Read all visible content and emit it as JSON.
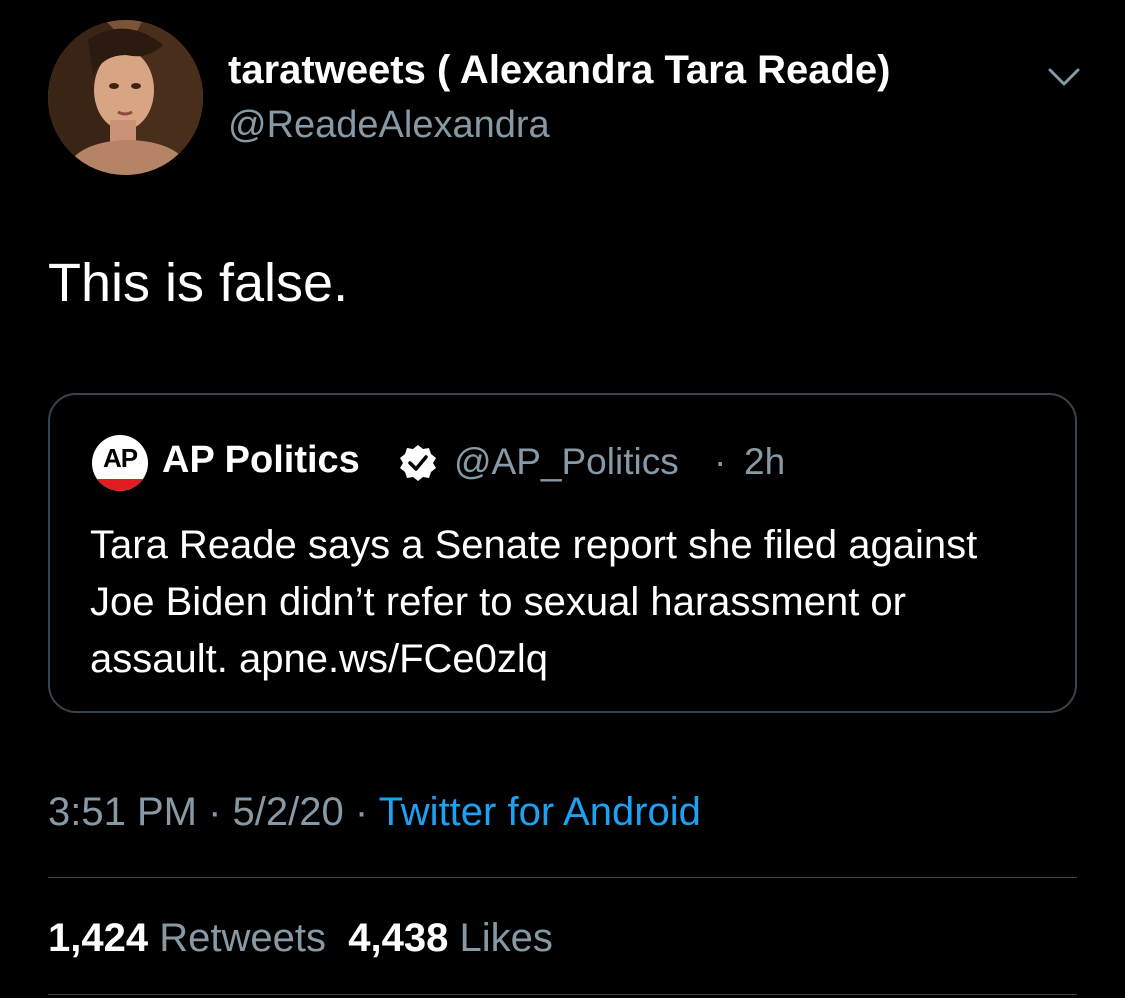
{
  "author": {
    "display_name": "taratweets ( Alexandra Tara Reade)",
    "handle": "@ReadeAlexandra"
  },
  "tweet": {
    "text": "This is false."
  },
  "quoted_tweet": {
    "logo_text": "AP",
    "name": "AP Politics",
    "verified": true,
    "handle": "@AP_Politics",
    "separator": "·",
    "time": "2h",
    "text": "Tara Reade says a Senate report she filed against Joe Biden didn’t refer to sexual harassment or assault. apne.ws/FCe0zlq"
  },
  "meta": {
    "time": "3:51 PM",
    "date": "5/2/20",
    "separator": " · ",
    "source": "Twitter for Android"
  },
  "stats": {
    "retweets_count": "1,424",
    "retweets_label": "Retweets",
    "likes_count": "4,438",
    "likes_label": "Likes"
  },
  "colors": {
    "background": "#000000",
    "primary_text": "#ffffff",
    "secondary_text": "#8899a6",
    "link": "#1da1f2",
    "border": "#38444d",
    "ap_red": "#e31b23"
  },
  "icons": {
    "menu": "chevron-down-icon",
    "verified": "verified-badge-icon"
  }
}
